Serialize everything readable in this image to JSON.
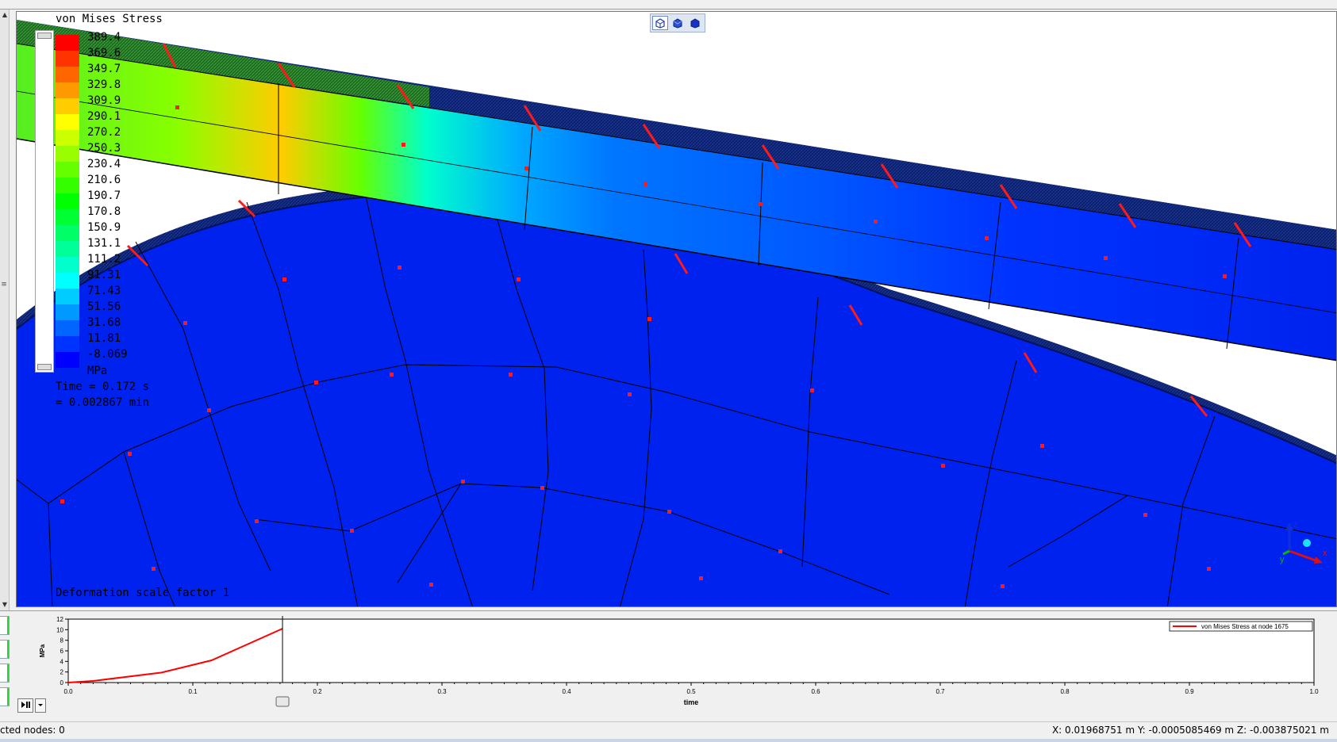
{
  "legend": {
    "title": "von Mises Stress",
    "values": [
      "389.4",
      "369.6",
      "349.7",
      "329.8",
      "309.9",
      "290.1",
      "270.2",
      "250.3",
      "230.4",
      "210.6",
      "190.7",
      "170.8",
      "150.9",
      "131.1",
      "111.2",
      "91.31",
      "71.43",
      "51.56",
      "31.68",
      "11.81",
      "-8.069"
    ],
    "colors": [
      "#ff0000",
      "#ff3300",
      "#ff6600",
      "#ff9900",
      "#ffcc00",
      "#ffff00",
      "#ccff00",
      "#99ff00",
      "#66ff00",
      "#33ff00",
      "#00ff00",
      "#00ff33",
      "#00ff66",
      "#00ff99",
      "#00ffcc",
      "#00ffff",
      "#00ccff",
      "#0099ff",
      "#0066ff",
      "#0033ff",
      "#0000ff"
    ],
    "unit": "MPa",
    "time_s": "Time = 0.172 s",
    "time_min": "= 0.002867 min"
  },
  "viewport": {
    "deformation_label": "Deformation scale factor 1",
    "view_buttons": [
      "iso-view-icon",
      "front-view-icon",
      "solid-view-icon"
    ]
  },
  "triad": {
    "x": "x",
    "y": "y",
    "z": "z"
  },
  "chart_data": {
    "type": "line",
    "xlabel": "time",
    "ylabel": "MPa",
    "xlim": [
      0.0,
      1.0
    ],
    "ylim": [
      0,
      12
    ],
    "xticks": [
      "0.0",
      "0.1",
      "0.2",
      "0.3",
      "0.4",
      "0.5",
      "0.6",
      "0.7",
      "0.8",
      "0.9",
      "1.0"
    ],
    "yticks": [
      "0",
      "2",
      "4",
      "6",
      "8",
      "10",
      "12"
    ],
    "series": [
      {
        "name": "von Mises Stress at node 1675",
        "color": "#ff0000",
        "x": [
          0.0,
          0.02,
          0.075,
          0.115,
          0.172
        ],
        "y": [
          0.0,
          0.3,
          1.9,
          4.2,
          10.2
        ]
      }
    ],
    "cursor_x": 0.172,
    "legend_position": "top-right",
    "grid": false
  },
  "statusbar": {
    "selected_nodes": "cted nodes: 0",
    "coords": "X: 0.01968751 m Y: -0.0005085469 m Z: -0.003875021 m"
  }
}
